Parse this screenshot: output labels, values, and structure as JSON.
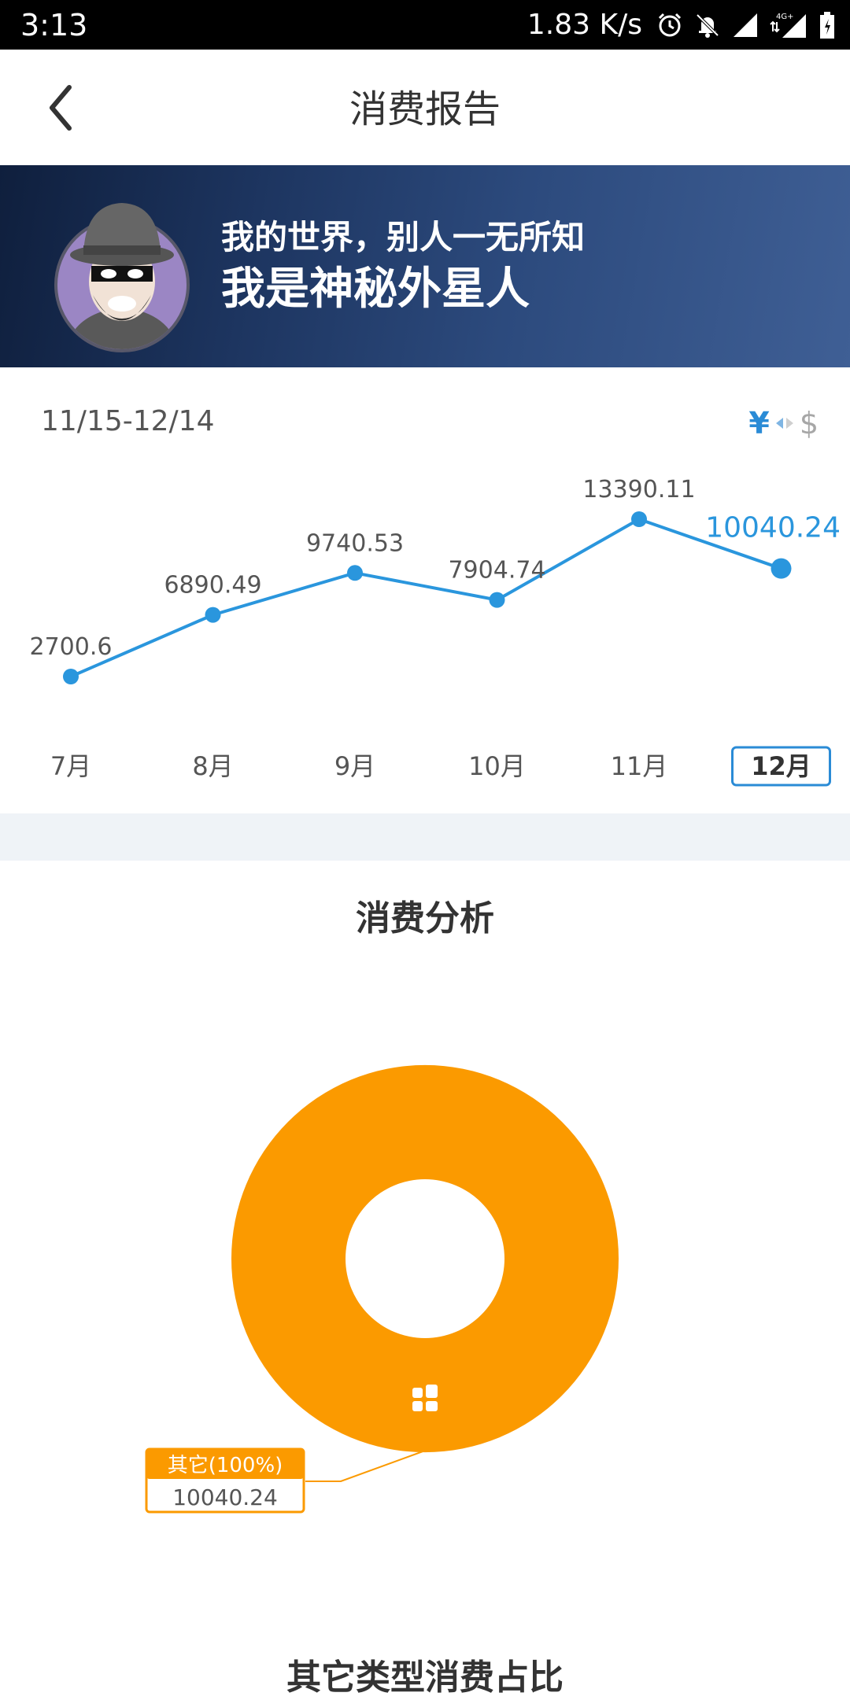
{
  "status_bar": {
    "time": "3:13",
    "net_speed": "1.83 K/s",
    "icons": [
      "alarm-icon",
      "notifications-off-icon",
      "signal-icon",
      "4g-signal-icon",
      "battery-icon"
    ]
  },
  "header": {
    "title": "消费报告",
    "back_icon": "back-arrow-icon"
  },
  "profile": {
    "tagline": "我的世界，别人一无所知",
    "nickname": "我是神秘外星人",
    "avatar_icon": "masked-person-avatar"
  },
  "report": {
    "date_range": "11/15-12/14",
    "currency_toggle": {
      "active": "¥",
      "inactive": "$",
      "icon": "swap-arrows-icon"
    }
  },
  "chart_data": [
    {
      "type": "line",
      "categories": [
        "7月",
        "8月",
        "9月",
        "10月",
        "11月",
        "12月"
      ],
      "values": [
        2700.6,
        6890.49,
        9740.53,
        7904.74,
        13390.11,
        10040.24
      ],
      "value_labels": [
        "2700.6",
        "6890.49",
        "9740.53",
        "7904.74",
        "13390.11",
        "10040.24"
      ],
      "selected": "12月",
      "ylim": [
        0,
        15000
      ],
      "grid": false,
      "color": "#2a96dd",
      "selected_label_color": "#2a96dd",
      "selected_border_color": "#2a8bd6"
    },
    {
      "type": "pie",
      "title": "消费分析",
      "donut": true,
      "slices": [
        {
          "label": "其它(100%)",
          "value": 10040.24,
          "value_label": "10040.24",
          "percent": 100,
          "color": "#fb9a00",
          "icon": "grid-category-icon"
        }
      ]
    }
  ],
  "next_section": {
    "title": "其它类型消费占比"
  },
  "colors": {
    "accent": "#2a8bd6",
    "donut": "#fb9a00",
    "divider": "#eff3f7",
    "text": "#333333"
  }
}
